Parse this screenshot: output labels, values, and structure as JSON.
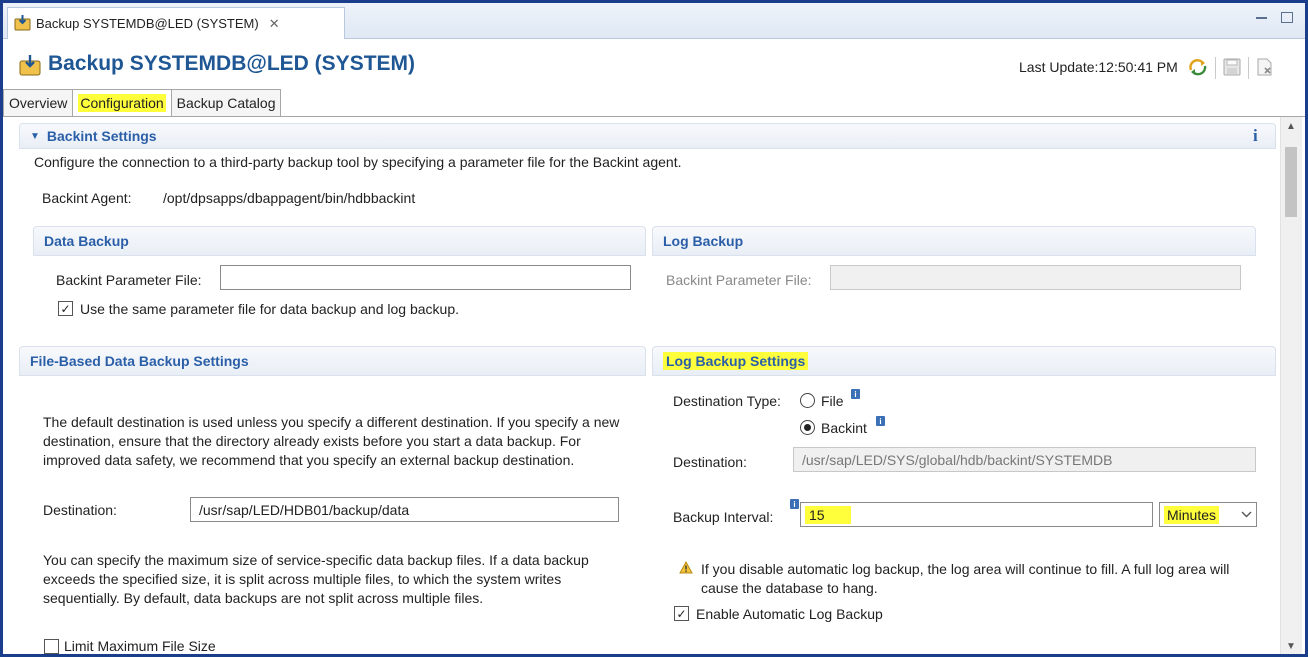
{
  "editor_tab": {
    "title": "Backup SYSTEMDB@LED (SYSTEM)"
  },
  "header": {
    "title": "Backup SYSTEMDB@LED (SYSTEM)",
    "last_update_label": "Last Update:",
    "last_update_time": "12:50:41 PM"
  },
  "tabs": [
    {
      "label": "Overview"
    },
    {
      "label": "Configuration"
    },
    {
      "label": "Backup Catalog"
    }
  ],
  "backint": {
    "title": "Backint Settings",
    "description": "Configure the connection to a third-party backup tool by specifying a parameter file for the Backint agent.",
    "agent_label": "Backint Agent:",
    "agent_path": "/opt/dpsapps/dbappagent/bin/hdbbackint",
    "info_glyph": "i",
    "data_backup": {
      "title": "Data Backup",
      "param_label": "Backint Parameter File:",
      "param_value": "",
      "same_file_label": "Use the same parameter file for data backup and log backup.",
      "same_file_checked": true
    },
    "log_backup": {
      "title": "Log Backup",
      "param_label": "Backint Parameter File:",
      "param_value": ""
    }
  },
  "file_based": {
    "title": "File-Based Data Backup Settings",
    "description": "The default destination is used unless you specify a different destination. If you specify a new destination, ensure that the directory already exists before you start a data backup. For improved data safety, we recommend that you specify an external backup destination.",
    "destination_label": "Destination:",
    "destination_value": "/usr/sap/LED/HDB01/backup/data",
    "max_size_description": "You can specify the maximum size of service-specific data backup files. If a data backup exceeds the specified size, it is split across multiple files, to which the system writes sequentially. By default, data backups are not split across multiple files.",
    "limit_label": "Limit Maximum File Size",
    "limit_checked": false
  },
  "log_settings": {
    "title": "Log Backup Settings",
    "destination_type_label": "Destination Type:",
    "option_file": "File",
    "option_backint": "Backint",
    "selected_option": "Backint",
    "destination_label": "Destination:",
    "destination_value": "/usr/sap/LED/SYS/global/hdb/backint/SYSTEMDB",
    "interval_label": "Backup Interval:",
    "interval_value": "15",
    "interval_unit": "Minutes",
    "warning_text": "If you disable automatic log backup, the log area will continue to fill. A full log area will cause the database to hang.",
    "enable_label": "Enable Automatic Log Backup",
    "enable_checked": true
  },
  "colors": {
    "accent": "#1f5694",
    "highlight": "#ffff3c",
    "section_text": "#2a5fa8"
  },
  "icons": [
    "backup-icon",
    "close-icon",
    "minimize-icon",
    "maximize-icon",
    "refresh-icon",
    "save-icon",
    "discard-icon",
    "info-icon",
    "warning-icon",
    "chevron-down-icon",
    "collapse-triangle-icon"
  ]
}
